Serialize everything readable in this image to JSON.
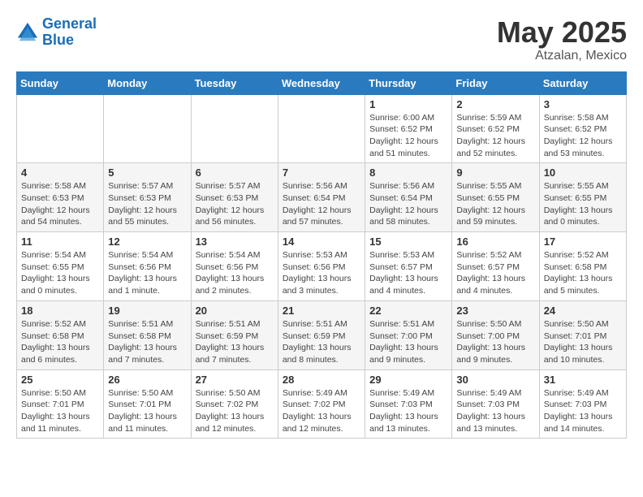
{
  "header": {
    "logo_line1": "General",
    "logo_line2": "Blue",
    "title": "May 2025",
    "subtitle": "Atzalan, Mexico"
  },
  "weekdays": [
    "Sunday",
    "Monday",
    "Tuesday",
    "Wednesday",
    "Thursday",
    "Friday",
    "Saturday"
  ],
  "weeks": [
    [
      {
        "day": "",
        "info": ""
      },
      {
        "day": "",
        "info": ""
      },
      {
        "day": "",
        "info": ""
      },
      {
        "day": "",
        "info": ""
      },
      {
        "day": "1",
        "info": "Sunrise: 6:00 AM\nSunset: 6:52 PM\nDaylight: 12 hours\nand 51 minutes."
      },
      {
        "day": "2",
        "info": "Sunrise: 5:59 AM\nSunset: 6:52 PM\nDaylight: 12 hours\nand 52 minutes."
      },
      {
        "day": "3",
        "info": "Sunrise: 5:58 AM\nSunset: 6:52 PM\nDaylight: 12 hours\nand 53 minutes."
      }
    ],
    [
      {
        "day": "4",
        "info": "Sunrise: 5:58 AM\nSunset: 6:53 PM\nDaylight: 12 hours\nand 54 minutes."
      },
      {
        "day": "5",
        "info": "Sunrise: 5:57 AM\nSunset: 6:53 PM\nDaylight: 12 hours\nand 55 minutes."
      },
      {
        "day": "6",
        "info": "Sunrise: 5:57 AM\nSunset: 6:53 PM\nDaylight: 12 hours\nand 56 minutes."
      },
      {
        "day": "7",
        "info": "Sunrise: 5:56 AM\nSunset: 6:54 PM\nDaylight: 12 hours\nand 57 minutes."
      },
      {
        "day": "8",
        "info": "Sunrise: 5:56 AM\nSunset: 6:54 PM\nDaylight: 12 hours\nand 58 minutes."
      },
      {
        "day": "9",
        "info": "Sunrise: 5:55 AM\nSunset: 6:55 PM\nDaylight: 12 hours\nand 59 minutes."
      },
      {
        "day": "10",
        "info": "Sunrise: 5:55 AM\nSunset: 6:55 PM\nDaylight: 13 hours\nand 0 minutes."
      }
    ],
    [
      {
        "day": "11",
        "info": "Sunrise: 5:54 AM\nSunset: 6:55 PM\nDaylight: 13 hours\nand 0 minutes."
      },
      {
        "day": "12",
        "info": "Sunrise: 5:54 AM\nSunset: 6:56 PM\nDaylight: 13 hours\nand 1 minute."
      },
      {
        "day": "13",
        "info": "Sunrise: 5:54 AM\nSunset: 6:56 PM\nDaylight: 13 hours\nand 2 minutes."
      },
      {
        "day": "14",
        "info": "Sunrise: 5:53 AM\nSunset: 6:56 PM\nDaylight: 13 hours\nand 3 minutes."
      },
      {
        "day": "15",
        "info": "Sunrise: 5:53 AM\nSunset: 6:57 PM\nDaylight: 13 hours\nand 4 minutes."
      },
      {
        "day": "16",
        "info": "Sunrise: 5:52 AM\nSunset: 6:57 PM\nDaylight: 13 hours\nand 4 minutes."
      },
      {
        "day": "17",
        "info": "Sunrise: 5:52 AM\nSunset: 6:58 PM\nDaylight: 13 hours\nand 5 minutes."
      }
    ],
    [
      {
        "day": "18",
        "info": "Sunrise: 5:52 AM\nSunset: 6:58 PM\nDaylight: 13 hours\nand 6 minutes."
      },
      {
        "day": "19",
        "info": "Sunrise: 5:51 AM\nSunset: 6:58 PM\nDaylight: 13 hours\nand 7 minutes."
      },
      {
        "day": "20",
        "info": "Sunrise: 5:51 AM\nSunset: 6:59 PM\nDaylight: 13 hours\nand 7 minutes."
      },
      {
        "day": "21",
        "info": "Sunrise: 5:51 AM\nSunset: 6:59 PM\nDaylight: 13 hours\nand 8 minutes."
      },
      {
        "day": "22",
        "info": "Sunrise: 5:51 AM\nSunset: 7:00 PM\nDaylight: 13 hours\nand 9 minutes."
      },
      {
        "day": "23",
        "info": "Sunrise: 5:50 AM\nSunset: 7:00 PM\nDaylight: 13 hours\nand 9 minutes."
      },
      {
        "day": "24",
        "info": "Sunrise: 5:50 AM\nSunset: 7:01 PM\nDaylight: 13 hours\nand 10 minutes."
      }
    ],
    [
      {
        "day": "25",
        "info": "Sunrise: 5:50 AM\nSunset: 7:01 PM\nDaylight: 13 hours\nand 11 minutes."
      },
      {
        "day": "26",
        "info": "Sunrise: 5:50 AM\nSunset: 7:01 PM\nDaylight: 13 hours\nand 11 minutes."
      },
      {
        "day": "27",
        "info": "Sunrise: 5:50 AM\nSunset: 7:02 PM\nDaylight: 13 hours\nand 12 minutes."
      },
      {
        "day": "28",
        "info": "Sunrise: 5:49 AM\nSunset: 7:02 PM\nDaylight: 13 hours\nand 12 minutes."
      },
      {
        "day": "29",
        "info": "Sunrise: 5:49 AM\nSunset: 7:03 PM\nDaylight: 13 hours\nand 13 minutes."
      },
      {
        "day": "30",
        "info": "Sunrise: 5:49 AM\nSunset: 7:03 PM\nDaylight: 13 hours\nand 13 minutes."
      },
      {
        "day": "31",
        "info": "Sunrise: 5:49 AM\nSunset: 7:03 PM\nDaylight: 13 hours\nand 14 minutes."
      }
    ]
  ]
}
